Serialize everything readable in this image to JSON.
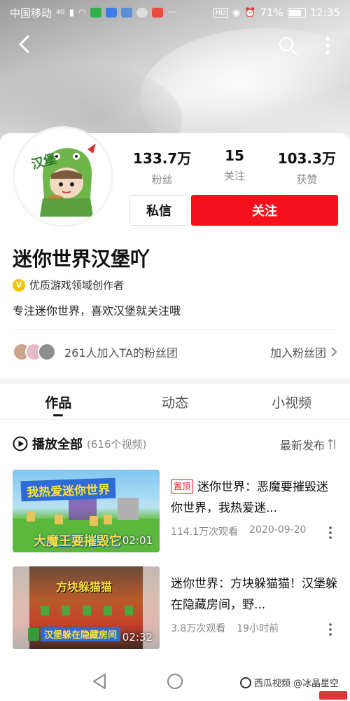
{
  "status_bar": {
    "carrier": "中国移动",
    "network": "4G",
    "battery": "71%",
    "battery_level": 0.71,
    "time": "12:35"
  },
  "header": {
    "back_icon": "chevron-left-icon",
    "search_icon": "search-icon",
    "more_icon": "more-vertical-icon"
  },
  "profile": {
    "name": "迷你世界汉堡吖",
    "verification": "优质游戏领域创作者",
    "bio": "专注迷你世界，喜欢汉堡就关注哦",
    "avatar_text": "汉堡",
    "stats": [
      {
        "value": "133.7万",
        "label": "粉丝"
      },
      {
        "value": "15",
        "label": "关注"
      },
      {
        "value": "103.3万",
        "label": "获赞"
      }
    ],
    "message_label": "私信",
    "follow_label": "关注",
    "follow_color": "#f5101d"
  },
  "fans_group": {
    "text": "261人加入TA的粉丝团",
    "join_label": "加入粉丝团"
  },
  "tabs": [
    {
      "label": "作品",
      "active": true
    },
    {
      "label": "动态",
      "active": false
    },
    {
      "label": "小视频",
      "active": false
    }
  ],
  "list_header": {
    "play_all": "播放全部",
    "count": "(616个视频)",
    "sort": "最新发布"
  },
  "videos": [
    {
      "pinned_label": "置顶",
      "title": "迷你世界：恶魔要摧毁迷你世界，我热爱迷...",
      "views": "114.1万次观看",
      "date": "2020-09-20",
      "duration": "02:01",
      "thumb_top": "我热爱迷你世界",
      "thumb_bottom": "大魔王要摧毁它"
    },
    {
      "pinned_label": "",
      "title": "迷你世界：方块躲猫猫！汉堡躲在隐藏房间，野...",
      "views": "3.8万次观看",
      "date": "19小时前",
      "duration": "02:32",
      "thumb_top": "方块躲猫猫",
      "thumb_bottom": "汉堡躲在隐藏房间"
    }
  ],
  "watermark": "西瓜视频 @冰晶星空"
}
